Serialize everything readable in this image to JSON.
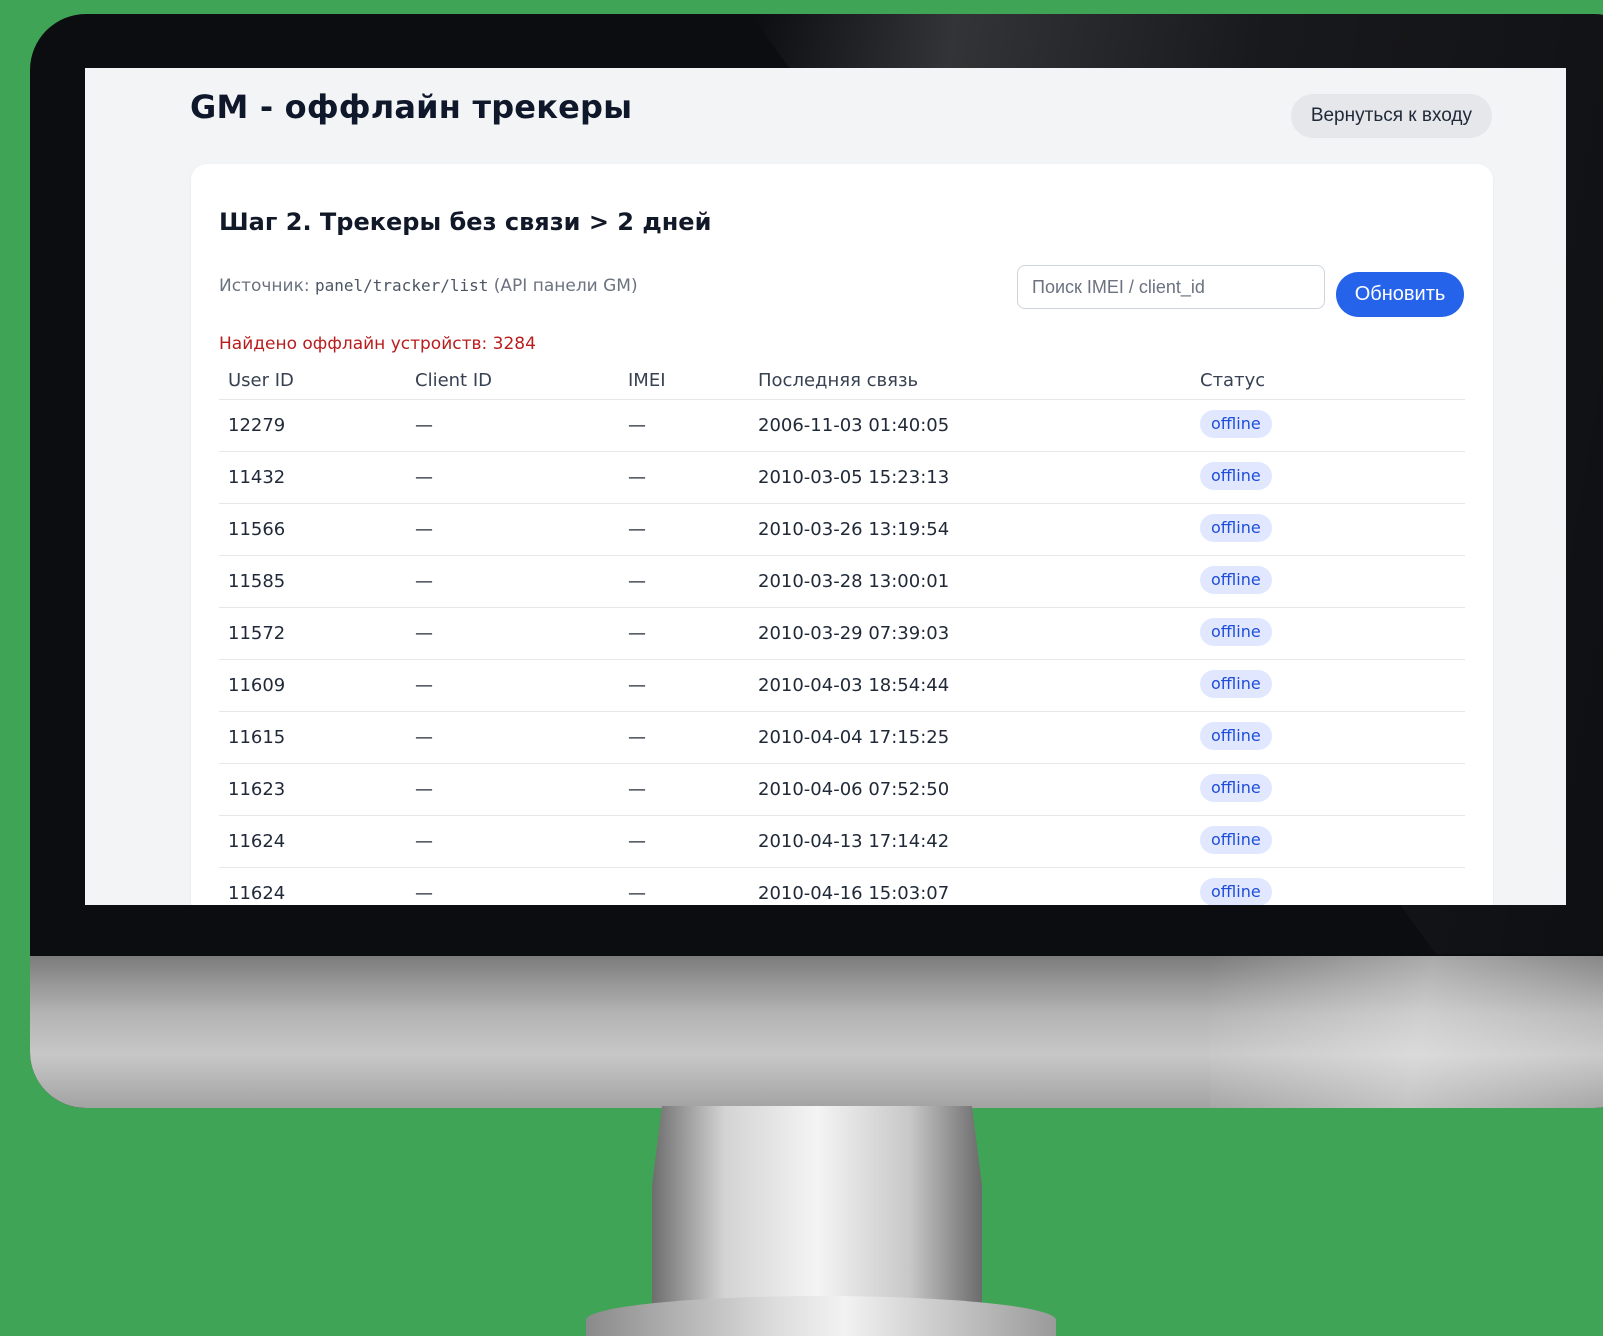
{
  "app": {
    "title": "GM - оффлайн трекеры",
    "back_button_label": "Вернуться к входу"
  },
  "panel": {
    "title": "Шаг 2. Трекеры без связи > 2 дней",
    "source_prefix": "Источник:",
    "source_path": "panel/tracker/list",
    "source_suffix": "(API панели GM)",
    "found_text": "Найдено оффлайн устройств: 3284"
  },
  "search": {
    "placeholder": "Поиск IMEI / client_id",
    "value": ""
  },
  "refresh_label": "Обновить",
  "table": {
    "headers": [
      "User ID",
      "Client ID",
      "IMEI",
      "Последняя связь",
      "Статус"
    ],
    "rows": [
      {
        "user_id": "12279",
        "client_id": "—",
        "imei": "—",
        "last_seen": "2006-11-03 01:40:05",
        "status": "offline"
      },
      {
        "user_id": "11432",
        "client_id": "—",
        "imei": "—",
        "last_seen": "2010-03-05 15:23:13",
        "status": "offline"
      },
      {
        "user_id": "11566",
        "client_id": "—",
        "imei": "—",
        "last_seen": "2010-03-26 13:19:54",
        "status": "offline"
      },
      {
        "user_id": "11585",
        "client_id": "—",
        "imei": "—",
        "last_seen": "2010-03-28 13:00:01",
        "status": "offline"
      },
      {
        "user_id": "11572",
        "client_id": "—",
        "imei": "—",
        "last_seen": "2010-03-29 07:39:03",
        "status": "offline"
      },
      {
        "user_id": "11609",
        "client_id": "—",
        "imei": "—",
        "last_seen": "2010-04-03 18:54:44",
        "status": "offline"
      },
      {
        "user_id": "11615",
        "client_id": "—",
        "imei": "—",
        "last_seen": "2010-04-04 17:15:25",
        "status": "offline"
      },
      {
        "user_id": "11623",
        "client_id": "—",
        "imei": "—",
        "last_seen": "2010-04-06 07:52:50",
        "status": "offline"
      },
      {
        "user_id": "11624",
        "client_id": "—",
        "imei": "—",
        "last_seen": "2010-04-13 17:14:42",
        "status": "offline"
      },
      {
        "user_id": "11624",
        "client_id": "—",
        "imei": "—",
        "last_seen": "2010-04-16 15:03:07",
        "status": "offline"
      }
    ]
  },
  "colors": {
    "background": "#3fa455",
    "accent": "#2563eb",
    "alert": "#b91c1c",
    "badge_bg": "#e0e7ff",
    "badge_text": "#1d4ed8"
  }
}
